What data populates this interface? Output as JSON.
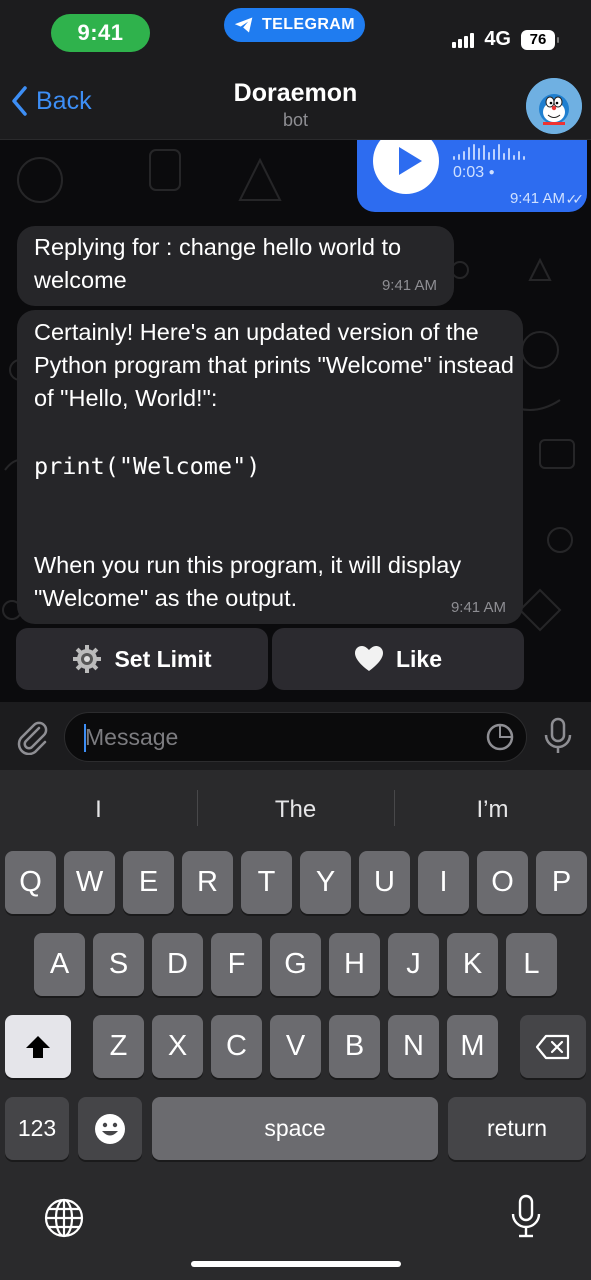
{
  "status_bar": {
    "time": "9:41",
    "app_pill": "TELEGRAM",
    "network": "4G",
    "battery": "76"
  },
  "header": {
    "back_label": "Back",
    "title": "Doraemon",
    "subtitle": "bot"
  },
  "messages": {
    "voice": {
      "duration": "0:03",
      "time": "9:41 AM"
    },
    "reply": {
      "text": "Replying for : change hello world to welcome",
      "time": "9:41 AM"
    },
    "answer": {
      "intro": "Certainly! Here's an updated version of the Python program that prints \"Welcome\" instead of \"Hello, World!\":",
      "code": "print(\"Welcome\")",
      "outro": "When you run this program, it will display \"Welcome\" as the output.",
      "time": "9:41 AM"
    }
  },
  "inline_buttons": [
    {
      "label": "Set Limit",
      "icon": "gear-icon"
    },
    {
      "label": "Like",
      "icon": "heart-icon"
    }
  ],
  "composer": {
    "placeholder": "Message"
  },
  "keyboard": {
    "suggestions": [
      "I",
      "The",
      "I’m"
    ],
    "row1": [
      "Q",
      "W",
      "E",
      "R",
      "T",
      "Y",
      "U",
      "I",
      "O",
      "P"
    ],
    "row2": [
      "A",
      "S",
      "D",
      "F",
      "G",
      "H",
      "J",
      "K",
      "L"
    ],
    "row3": [
      "Z",
      "X",
      "C",
      "V",
      "B",
      "N",
      "M"
    ],
    "numbers_key": "123",
    "space_key": "space",
    "return_key": "return"
  }
}
